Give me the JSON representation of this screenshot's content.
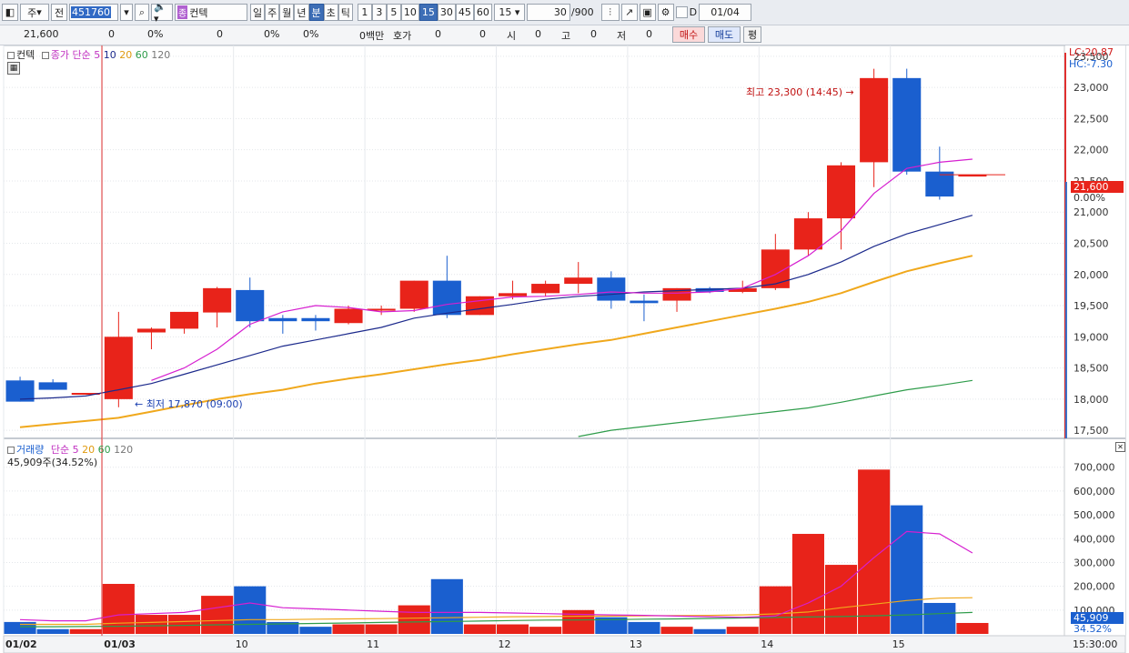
{
  "toolbar": {
    "stock_btn": "주",
    "prev_btn": "전",
    "code_value": "451760",
    "name_tag": "종",
    "name_value": "컨텍",
    "periods": [
      "일",
      "주",
      "월",
      "년",
      "분",
      "초",
      "틱"
    ],
    "selected_period": "분",
    "intervals": [
      "1",
      "3",
      "5",
      "10",
      "15",
      "30",
      "45",
      "60"
    ],
    "selected_interval": "15",
    "interval_select": "15",
    "pager": "30",
    "pager_total": "/900",
    "checkbox_label": "D",
    "date_value": "01/04"
  },
  "quote": {
    "price": "21,600",
    "change": "0",
    "change_pct": "0%",
    "volume": "0",
    "volume_pct": "0%",
    "v2": "0%",
    "amount": "0백만",
    "hoga_label": "호가",
    "hoga1": "0",
    "hoga2": "0",
    "open_label": "시",
    "open": "0",
    "high_label": "고",
    "high": "0",
    "low_label": "저",
    "low": "0",
    "buy_btn": "매수",
    "sell_btn": "매도",
    "avg_btn": "평"
  },
  "price_panel": {
    "stock_name": "컨텍",
    "legend_title": "종가 단순",
    "ma_labels": [
      "5",
      "10",
      "20",
      "60",
      "120"
    ],
    "right_top_lc": "LC:20.87",
    "right_top_hc": "HC:-7.30",
    "high_note": "최고 23,300 (14:45)",
    "low_note": "최저 17,870 (09:00)",
    "current_price_tag": "21,600",
    "current_pct_tag": "0.00%",
    "y_ticks": [
      "23,500",
      "23,000",
      "22,500",
      "22,000",
      "21,500",
      "21,000",
      "20,500",
      "20,000",
      "19,500",
      "19,000",
      "18,500",
      "18,000",
      "17,500"
    ]
  },
  "volume_panel": {
    "legend_title": "거래량",
    "legend_sub": "단순",
    "ma_labels": [
      "5",
      "20",
      "60",
      "120"
    ],
    "info": "45,909주(34.52%)",
    "current_vol_tag": "45,909",
    "current_pct_tag": "34.52%",
    "y_ticks": [
      "700,000",
      "600,000",
      "500,000",
      "400,000",
      "300,000",
      "200,000",
      "100,000"
    ]
  },
  "x_axis": {
    "labels": [
      "01/02",
      "01/03",
      "10",
      "11",
      "12",
      "13",
      "14",
      "15"
    ],
    "time_right": "15:30:00"
  },
  "colors": {
    "up": "#e8231a",
    "down": "#1a5fcf",
    "ma5": "#d61fd0",
    "ma10": "#1c2a8c",
    "ma20": "#f0a81c",
    "ma60": "#2e9c4a"
  },
  "chart_data": {
    "type": "candlestick",
    "price_ylim": [
      17400,
      23600
    ],
    "volume_ylim": [
      0,
      760000
    ],
    "candles": [
      {
        "o": 18300,
        "h": 18360,
        "l": 17960,
        "c": 17960,
        "v": 50000
      },
      {
        "o": 18270,
        "h": 18320,
        "l": 18150,
        "c": 18150,
        "v": 20000
      },
      {
        "o": 18100,
        "h": 18100,
        "l": 18100,
        "c": 18100,
        "v": 20000
      },
      {
        "o": 18000,
        "h": 19400,
        "l": 17870,
        "c": 19000,
        "v": 210000
      },
      {
        "o": 19070,
        "h": 19150,
        "l": 18800,
        "c": 19130,
        "v": 80000
      },
      {
        "o": 19130,
        "h": 19400,
        "l": 19050,
        "c": 19400,
        "v": 80000
      },
      {
        "o": 19390,
        "h": 19800,
        "l": 19150,
        "c": 19780,
        "v": 160000
      },
      {
        "o": 19750,
        "h": 19950,
        "l": 19150,
        "c": 19250,
        "v": 200000
      },
      {
        "o": 19300,
        "h": 19350,
        "l": 19050,
        "c": 19250,
        "v": 50000
      },
      {
        "o": 19300,
        "h": 19350,
        "l": 19100,
        "c": 19250,
        "v": 30000
      },
      {
        "o": 19220,
        "h": 19500,
        "l": 19200,
        "c": 19450,
        "v": 40000
      },
      {
        "o": 19420,
        "h": 19500,
        "l": 19350,
        "c": 19450,
        "v": 40000
      },
      {
        "o": 19450,
        "h": 19900,
        "l": 19400,
        "c": 19900,
        "v": 120000
      },
      {
        "o": 19900,
        "h": 20300,
        "l": 19300,
        "c": 19350,
        "v": 230000
      },
      {
        "o": 19350,
        "h": 19650,
        "l": 19350,
        "c": 19650,
        "v": 40000
      },
      {
        "o": 19650,
        "h": 19900,
        "l": 19600,
        "c": 19700,
        "v": 40000
      },
      {
        "o": 19700,
        "h": 19900,
        "l": 19650,
        "c": 19850,
        "v": 30000
      },
      {
        "o": 19850,
        "h": 20200,
        "l": 19700,
        "c": 19950,
        "v": 100000
      },
      {
        "o": 19950,
        "h": 20050,
        "l": 19450,
        "c": 19580,
        "v": 70000
      },
      {
        "o": 19580,
        "h": 19680,
        "l": 19250,
        "c": 19540,
        "v": 50000
      },
      {
        "o": 19580,
        "h": 19780,
        "l": 19400,
        "c": 19780,
        "v": 30000
      },
      {
        "o": 19780,
        "h": 19800,
        "l": 19700,
        "c": 19720,
        "v": 20000
      },
      {
        "o": 19720,
        "h": 19900,
        "l": 19700,
        "c": 19780,
        "v": 30000
      },
      {
        "o": 19780,
        "h": 20650,
        "l": 19750,
        "c": 20400,
        "v": 200000
      },
      {
        "o": 20400,
        "h": 21000,
        "l": 20300,
        "c": 20900,
        "v": 420000
      },
      {
        "o": 20900,
        "h": 21800,
        "l": 20400,
        "c": 21750,
        "v": 290000
      },
      {
        "o": 21800,
        "h": 23300,
        "l": 21400,
        "c": 23150,
        "v": 690000
      },
      {
        "o": 23150,
        "h": 23300,
        "l": 21600,
        "c": 21650,
        "v": 540000
      },
      {
        "o": 21650,
        "h": 22050,
        "l": 21200,
        "c": 21250,
        "v": 130000
      },
      {
        "o": 21600,
        "h": 21600,
        "l": 21600,
        "c": 21600,
        "v": 45909
      }
    ],
    "ma5": [
      null,
      null,
      null,
      null,
      18300,
      18500,
      18800,
      19200,
      19400,
      19500,
      19470,
      19400,
      19420,
      19520,
      19580,
      19640,
      19650,
      19680,
      19720,
      19700,
      19700,
      19720,
      19780,
      20000,
      20300,
      20700,
      21300,
      21700,
      21800,
      21850
    ],
    "ma10": [
      18000,
      18020,
      18050,
      18150,
      18250,
      18400,
      18550,
      18700,
      18850,
      18950,
      19050,
      19150,
      19300,
      19380,
      19450,
      19520,
      19600,
      19650,
      19680,
      19720,
      19740,
      19760,
      19780,
      19850,
      20000,
      20200,
      20450,
      20650,
      20800,
      20950
    ],
    "ma20": [
      17550,
      17600,
      17650,
      17700,
      17800,
      17900,
      18000,
      18080,
      18150,
      18250,
      18330,
      18400,
      18480,
      18560,
      18630,
      18720,
      18800,
      18880,
      18950,
      19050,
      19150,
      19250,
      19350,
      19450,
      19560,
      19700,
      19880,
      20050,
      20180,
      20300
    ],
    "ma60": [
      null,
      null,
      null,
      null,
      null,
      null,
      null,
      null,
      null,
      null,
      null,
      null,
      null,
      null,
      null,
      null,
      null,
      17400,
      17500,
      17560,
      17620,
      17680,
      17740,
      17800,
      17860,
      17950,
      18050,
      18150,
      18220,
      18300
    ],
    "vma5": [
      60000,
      55000,
      55000,
      80000,
      85000,
      90000,
      110000,
      130000,
      110000,
      105000,
      100000,
      95000,
      90000,
      90000,
      90000,
      88000,
      85000,
      82000,
      80000,
      78000,
      75000,
      72000,
      70000,
      75000,
      130000,
      200000,
      320000,
      430000,
      420000,
      340000
    ],
    "vma20": [
      40000,
      40000,
      40000,
      45000,
      48000,
      52000,
      56000,
      60000,
      60000,
      62000,
      63000,
      64000,
      66000,
      68000,
      70000,
      72000,
      73000,
      74000,
      75000,
      76000,
      77000,
      78000,
      80000,
      84000,
      92000,
      110000,
      125000,
      140000,
      150000,
      152000
    ],
    "vma60": [
      30000,
      30000,
      31000,
      32000,
      34000,
      36000,
      38000,
      40000,
      42000,
      44000,
      46000,
      48000,
      50000,
      52000,
      54000,
      56000,
      58000,
      59000,
      60000,
      62000,
      63000,
      65000,
      67000,
      69000,
      71000,
      73000,
      76000,
      80000,
      85000,
      90000
    ]
  }
}
